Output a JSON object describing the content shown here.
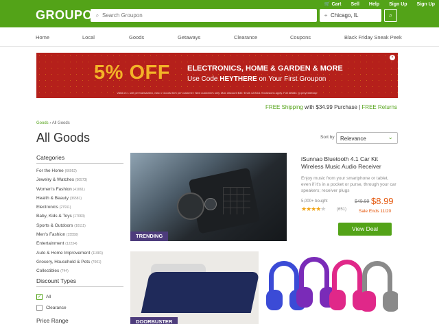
{
  "header": {
    "logo": "GROUPON",
    "links": [
      {
        "icon": "cart-icon",
        "label": "Cart"
      },
      {
        "icon": "",
        "label": "Sell"
      },
      {
        "icon": "",
        "label": "Help"
      },
      {
        "icon": "",
        "label": "Sign Up"
      },
      {
        "icon": "",
        "label": "Sign Up"
      }
    ],
    "search_placeholder": "Search Groupon",
    "location_value": "Chicago, IL"
  },
  "nav": {
    "items": [
      "Home",
      "Local",
      "Goods",
      "Getaways",
      "Clearance",
      "Coupons",
      "Black Friday Sneak Peek"
    ]
  },
  "promo": {
    "headline": "5% OFF",
    "line1": "ELECTRONICS, HOME & GARDEN & MORE",
    "line2_prefix": "Use Code ",
    "line2_code": "HEYTHERE",
    "line2_suffix": " on Your First Groupon",
    "fine_print": "Valid on 1 unit per transaction, max 1 Goods item per customer. New customers only. Max discount $30. Ends 12/3/16. Exclusions apply. Full details: gr.pn/yesterday."
  },
  "shipping": {
    "free_shipping": "FREE Shipping",
    "with": " with $34.99 Purchase | ",
    "free_returns": "FREE Returns"
  },
  "breadcrumb": {
    "parent": "Goods",
    "current": "All Goods"
  },
  "page_title": "All Goods",
  "sort": {
    "label": "Sort by",
    "value": "Relevance"
  },
  "categories": {
    "title": "Categories",
    "items": [
      {
        "name": "For the Home",
        "count": "(66052)"
      },
      {
        "name": "Jewelry & Watches",
        "count": "(50573)"
      },
      {
        "name": "Women's Fashion",
        "count": "(41061)"
      },
      {
        "name": "Health & Beauty",
        "count": "(36581)"
      },
      {
        "name": "Electronics",
        "count": "(27911)"
      },
      {
        "name": "Baby, Kids & Toys",
        "count": "(17063)"
      },
      {
        "name": "Sports & Outdoors",
        "count": "(16111)"
      },
      {
        "name": "Men's Fashion",
        "count": "(15550)"
      },
      {
        "name": "Entertainment",
        "count": "(12234)"
      },
      {
        "name": "Auto & Home Improvement",
        "count": "(11081)"
      },
      {
        "name": "Grocery, Household & Pets",
        "count": "(7001)"
      },
      {
        "name": "Collectibles",
        "count": "(744)"
      }
    ]
  },
  "discount_types": {
    "title": "Discount Types",
    "options": [
      {
        "label": "All",
        "checked": true
      },
      {
        "label": "Clearance",
        "checked": false
      }
    ]
  },
  "price_range": {
    "title": "Price Range"
  },
  "product1": {
    "badge": "TRENDING",
    "title": "iSunnao Bluetooth 4.1 Car Kit Wireless Music Audio Receiver",
    "description": "Enjoy music from your smartphone or tablet, even if it's in a pocket or purse, through your car speakers; receiver plugs",
    "bought": "5,000+ bought",
    "rating": 4,
    "rating_count": "(651)",
    "old_price": "$49.99",
    "new_price": "$8.99",
    "ends": "Sale Ends 11/20",
    "cta": "View Deal"
  },
  "product2": {
    "badge": "DOORBUSTER"
  },
  "colors": {
    "brand_green": "#53a318",
    "promo_red": "#b5201b",
    "price_orange": "#e35205",
    "badge_purple": "#4d3c7c"
  }
}
